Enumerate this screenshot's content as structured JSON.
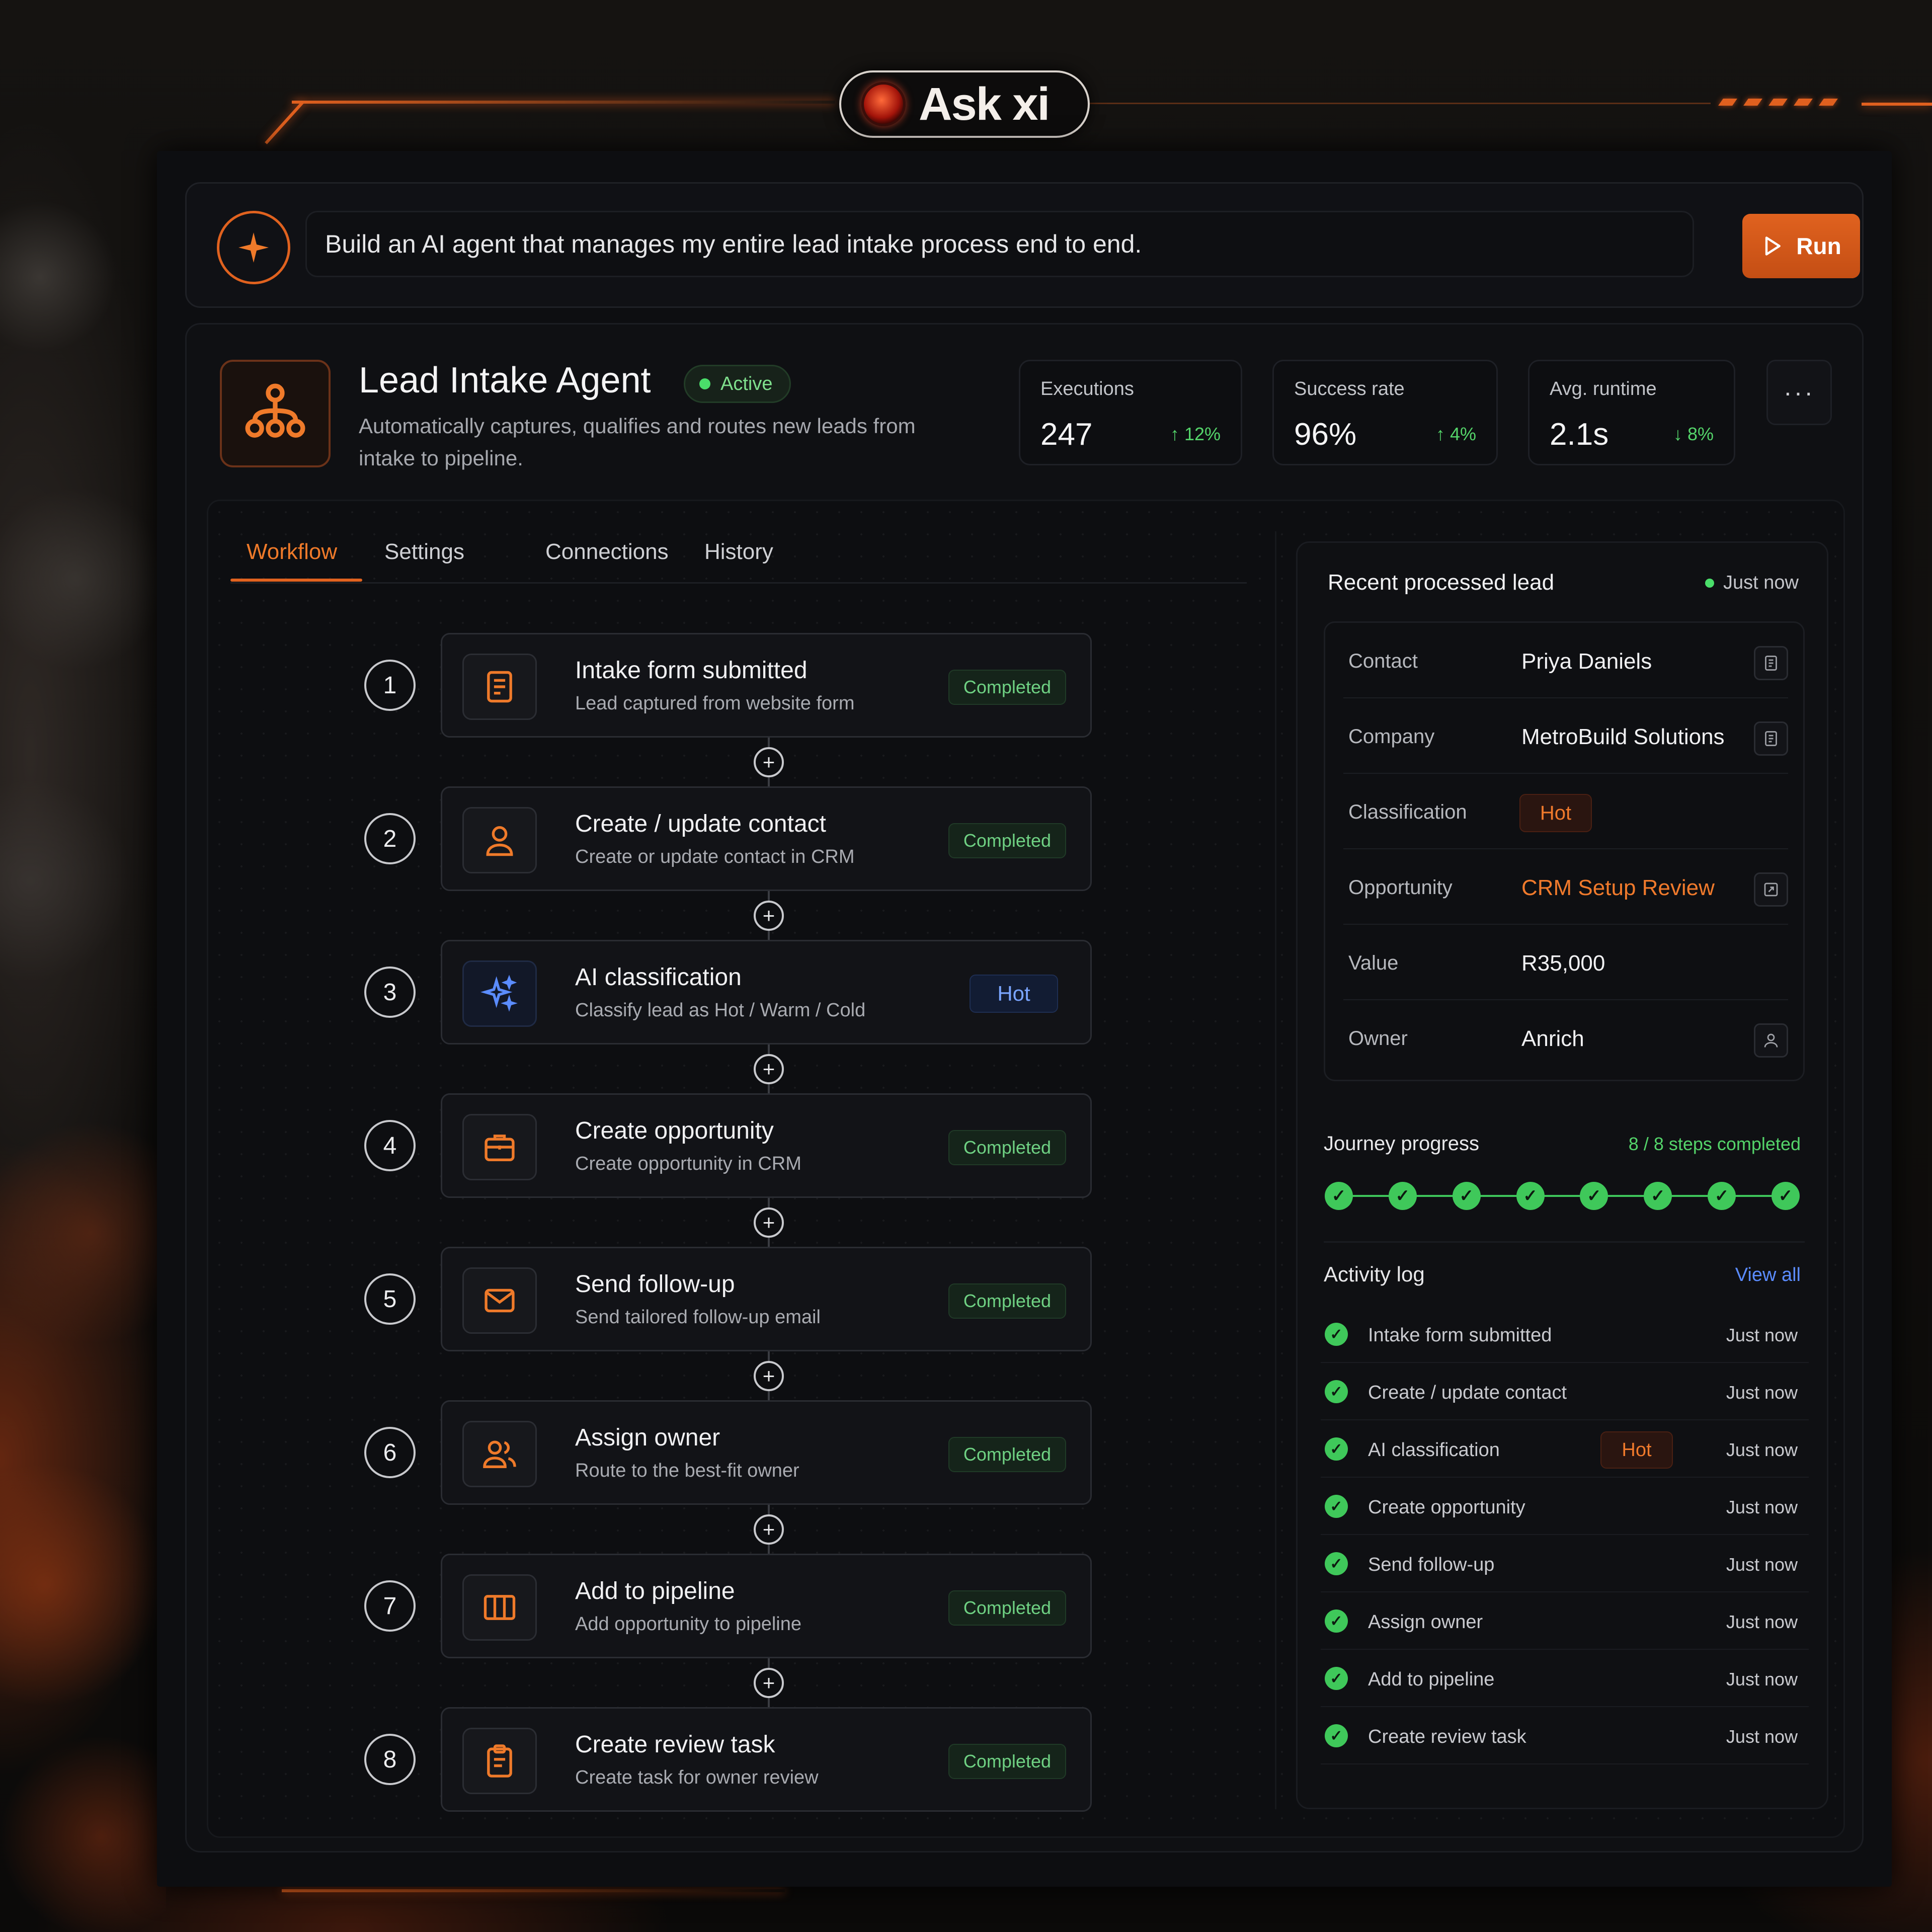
{
  "brand": {
    "name": "Ask xi"
  },
  "prompt": {
    "text": "Build an AI agent that manages my entire lead intake process end to end.",
    "run_label": "Run"
  },
  "agent": {
    "title": "Lead Intake Agent",
    "status": "Active",
    "description": "Automatically captures, qualifies and routes new leads from intake to pipeline.",
    "more_label": "···"
  },
  "stats": [
    {
      "label": "Executions",
      "value": "247",
      "delta": "↑ 12%"
    },
    {
      "label": "Success rate",
      "value": "96%",
      "delta": "↑ 4%"
    },
    {
      "label": "Avg. runtime",
      "value": "2.1s",
      "delta": "↓ 8%"
    }
  ],
  "tabs": [
    "Workflow",
    "Settings",
    "Connections",
    "History"
  ],
  "active_tab": "Workflow",
  "steps": [
    {
      "num": "1",
      "title": "Intake form submitted",
      "sub": "Lead captured from website form",
      "status": "Completed",
      "icon": "form-icon"
    },
    {
      "num": "2",
      "title": "Create / update contact",
      "sub": "Create or update contact in CRM",
      "status": "Completed",
      "icon": "user-icon"
    },
    {
      "num": "3",
      "title": "AI classification",
      "sub": "Classify lead as Hot / Warm / Cold",
      "status": "Hot",
      "icon": "sparkles-icon"
    },
    {
      "num": "4",
      "title": "Create opportunity",
      "sub": "Create opportunity in CRM",
      "status": "Completed",
      "icon": "briefcase-icon"
    },
    {
      "num": "5",
      "title": "Send follow-up",
      "sub": "Send tailored follow-up email",
      "status": "Completed",
      "icon": "mail-icon"
    },
    {
      "num": "6",
      "title": "Assign owner",
      "sub": "Route to the best-fit owner",
      "status": "Completed",
      "icon": "users-icon"
    },
    {
      "num": "7",
      "title": "Add to pipeline",
      "sub": "Add opportunity to pipeline",
      "status": "Completed",
      "icon": "columns-icon"
    },
    {
      "num": "8",
      "title": "Create review task",
      "sub": "Create task for owner review",
      "status": "Completed",
      "icon": "clipboard-icon"
    }
  ],
  "recent_lead": {
    "heading": "Recent processed lead",
    "time": "Just now",
    "fields": [
      {
        "key": "Contact",
        "value": "Priya Daniels"
      },
      {
        "key": "Company",
        "value": "MetroBuild Solutions"
      },
      {
        "key": "Classification",
        "value": "Hot"
      },
      {
        "key": "Opportunity",
        "value": "CRM Setup Review"
      },
      {
        "key": "Value",
        "value": "R35,000"
      },
      {
        "key": "Owner",
        "value": "Anrich"
      }
    ]
  },
  "journey": {
    "heading": "Journey progress",
    "count_text": "8 / 8 steps completed",
    "completed": 8,
    "total": 8
  },
  "activity": {
    "heading": "Activity log",
    "view_all": "View all",
    "items": [
      {
        "label": "Intake form submitted",
        "time": "Just now"
      },
      {
        "label": "Create / update contact",
        "time": "Just now"
      },
      {
        "label": "AI classification",
        "time": "Just now",
        "badge": "Hot"
      },
      {
        "label": "Create opportunity",
        "time": "Just now"
      },
      {
        "label": "Send follow-up",
        "time": "Just now"
      },
      {
        "label": "Assign owner",
        "time": "Just now"
      },
      {
        "label": "Add to pipeline",
        "time": "Just now"
      },
      {
        "label": "Create review task",
        "time": "Just now"
      }
    ]
  },
  "colors": {
    "accent": "#e0621f",
    "success": "#3fc85a",
    "info": "#5b8cff"
  }
}
